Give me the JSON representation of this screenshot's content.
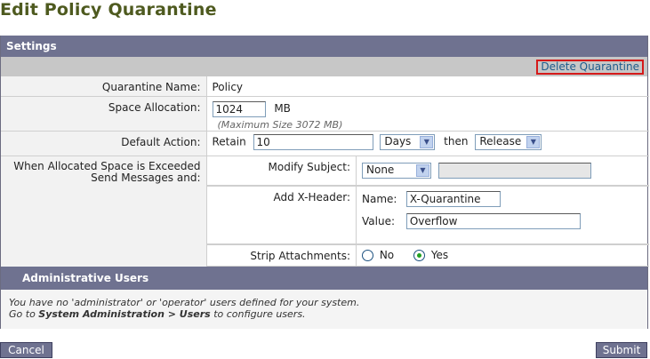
{
  "page_title": "Edit Policy Quarantine",
  "settings": {
    "header": "Settings",
    "delete_link": "Delete Quarantine",
    "rows": {
      "name_label": "Quarantine Name:",
      "name_value": "Policy",
      "space_label": "Space Allocation:",
      "space_value": "1024",
      "space_unit": "MB",
      "space_note": "(Maximum Size 3072 MB)",
      "default_action_label": "Default Action:",
      "retain_label": "Retain",
      "retain_value": "10",
      "retain_unit_selected": "Days",
      "then_label": "then",
      "then_action_selected": "Release",
      "exceeded_label_1": "When Allocated Space is Exceeded",
      "exceeded_label_2": "Send Messages and:",
      "modify_subject_label": "Modify Subject:",
      "modify_subject_selected": "None",
      "modify_subject_text": "",
      "add_xheader_label": "Add X-Header:",
      "xheader_name_label": "Name:",
      "xheader_name_value": "X-Quarantine",
      "xheader_value_label": "Value:",
      "xheader_value_value": "Overflow",
      "strip_label": "Strip Attachments:",
      "strip_no": "No",
      "strip_yes": "Yes",
      "strip_selected": "Yes"
    }
  },
  "admin": {
    "header": "Administrative Users",
    "line1": "You have no 'administrator' or 'operator' users defined for your system.",
    "line2_pre": "Go to ",
    "line2_bold": "System Administration > Users",
    "line2_post": " to configure users."
  },
  "buttons": {
    "cancel": "Cancel",
    "submit": "Submit"
  },
  "colors": {
    "header_bg": "#6f7290",
    "title": "#4e5a1f",
    "delete_border": "#d51a1a",
    "link": "#1f5c8c"
  }
}
